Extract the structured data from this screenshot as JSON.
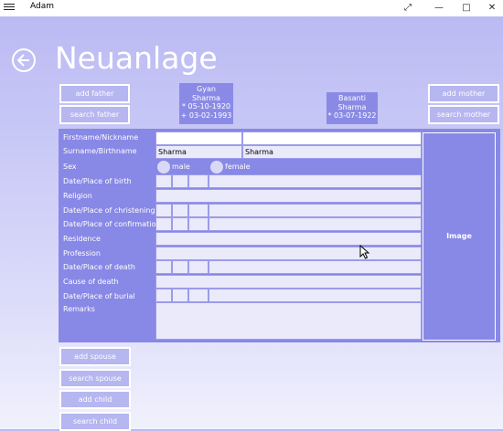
{
  "window": {
    "title": "Adam",
    "icons": [
      "menu-icon",
      "expand-icon",
      "minimize-icon",
      "maximize-icon",
      "close-icon"
    ]
  },
  "page": {
    "title": "Neuanlage"
  },
  "buttons": {
    "add_father": "add father",
    "search_father": "search father",
    "add_mother": "add mother",
    "search_mother": "search mother",
    "add_spouse": "add spouse",
    "search_spouse": "search spouse",
    "add_child": "add child",
    "search_child": "search child"
  },
  "father": {
    "first": "Gyan",
    "last": "Sharma",
    "birth": "* 05-10-1920",
    "death": "+ 03-02-1993"
  },
  "mother": {
    "first": "Basanti",
    "last": "Sharma",
    "birth": "* 03-07-1922"
  },
  "form": {
    "labels": {
      "firstname": "Firstname/Nickname",
      "surname": "Surname/Birthname",
      "sex": "Sex",
      "birth": "Date/Place of birth",
      "religion": "Religion",
      "christening": "Date/Place of christening",
      "confirmation": "Date/Place of confirmation",
      "residence": "Residence",
      "profession": "Profession",
      "death": "Date/Place of death",
      "cause": "Cause of death",
      "burial": "Date/Place of burial",
      "remarks": "Remarks"
    },
    "values": {
      "firstname": "",
      "nickname": "",
      "surname": "Sharma",
      "birthname": "Sharma"
    },
    "sex_options": [
      "male",
      "female"
    ],
    "image_label": "Image"
  },
  "colors": {
    "panel": "#8888e6",
    "button": "#b6b6f1",
    "field": "#eaeafb",
    "accent_white": "#ffffff"
  }
}
